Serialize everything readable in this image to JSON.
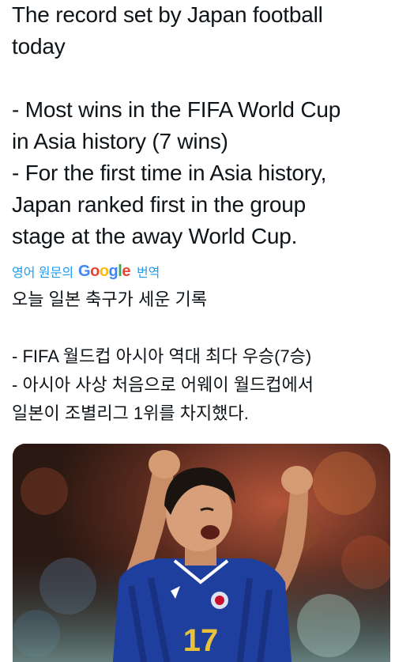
{
  "tweet": {
    "text_lines": [
      "The record set by Japan football",
      "today",
      "",
      "- Most wins in the FIFA World Cup",
      "in Asia history (7 wins)",
      "- For the first time in Asia history,",
      "Japan ranked first in the group",
      "stage at the away World Cup."
    ]
  },
  "translate": {
    "prefix": "영어 원문의",
    "provider": "Google",
    "suffix": "번역"
  },
  "translation": {
    "lines": [
      "오늘 일본 축구가 세운 기록",
      "",
      "- FIFA 월드컵 아시아 역대 최다 우승(7승)",
      "- 아시아 사상 처음으로 어웨이 월드컵에서",
      "일본이 조별리그 1위를 차지했다."
    ]
  },
  "media": {
    "jersey_number": "17",
    "colors": {
      "jersey": "#1f3f9e",
      "jersey_dark": "#152c73",
      "number": "#e8c33a",
      "skin": "#d7a07a",
      "hair": "#1a1410"
    }
  }
}
